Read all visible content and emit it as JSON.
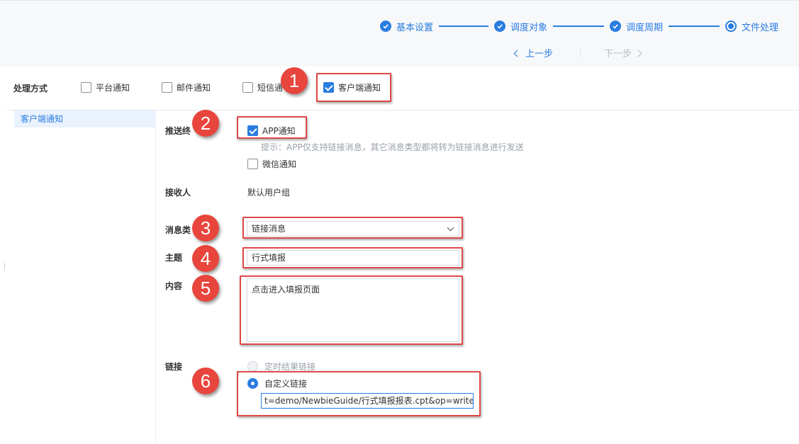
{
  "steps": [
    {
      "label": "基本设置",
      "state": "done"
    },
    {
      "label": "调度对象",
      "state": "done"
    },
    {
      "label": "调度周期",
      "state": "done"
    },
    {
      "label": "文件处理",
      "state": "current"
    }
  ],
  "nav": {
    "prev": "上一步",
    "next": "下一步"
  },
  "method": {
    "label": "处理方式",
    "options": [
      {
        "label": "平台通知",
        "checked": false
      },
      {
        "label": "邮件通知",
        "checked": false
      },
      {
        "label": "短信通",
        "checked": false
      },
      {
        "label": "客户端通知",
        "checked": true
      }
    ]
  },
  "sidebar": {
    "items": [
      {
        "label": "客户端通知"
      }
    ]
  },
  "form": {
    "push_label": "推送终",
    "app_notify": "APP通知",
    "app_hint": "提示：APP仅支持链接消息，其它消息类型都将转为链接消息进行发送",
    "wechat_notify": "微信通知",
    "receiver_label": "接收人",
    "receiver_value": "默认用户组",
    "msgtype_label": "消息类",
    "msgtype_value": "链接消息",
    "subject_label": "主题",
    "subject_value": "行式填报",
    "content_label": "内容",
    "content_value": "点击进入填报页面",
    "link_label": "链接",
    "link_timed": "定时结果链接",
    "link_custom": "自定义链接",
    "link_value": "t=demo/NewbieGuide/行式填报报表.cpt&op=write"
  },
  "badges": [
    "1",
    "2",
    "3",
    "4",
    "5",
    "6"
  ],
  "colors": {
    "accent": "#2a7de1",
    "highlight": "#e04848",
    "badge": "#e8453c"
  }
}
